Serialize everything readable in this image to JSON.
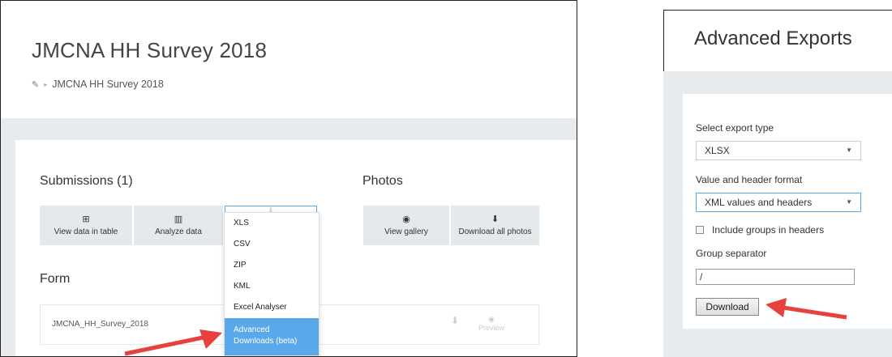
{
  "left": {
    "project_title": "JMCNA HH Survey 2018",
    "breadcrumb": {
      "icon": "link-icon",
      "separator": "▸",
      "item": "JMCNA HH Survey 2018"
    },
    "submissions_title": "Submissions (1)",
    "photos_title": "Photos",
    "form_title": "Form",
    "tiles": {
      "view_table": {
        "icon": "table-icon",
        "glyph": "⊞",
        "label": "View data in table"
      },
      "analyze": {
        "icon": "bar-chart-icon",
        "glyph": "▥",
        "label": "Analyze data"
      },
      "export": {
        "icon": "download-icon",
        "glyph": "⬇"
      },
      "gallery": {
        "icon": "eye-icon",
        "glyph": "◉",
        "label": "View gallery"
      },
      "download_photos": {
        "icon": "download-icon",
        "glyph": "⬇",
        "label": "Download all photos"
      }
    },
    "export_menu": [
      "XLS",
      "CSV",
      "ZIP",
      "KML",
      "Excel Analyser"
    ],
    "export_menu_active": "Advanced Downloads (beta)",
    "form_row": {
      "name": "JMCNA_HH_Survey_2018",
      "download_glyph": "⬇",
      "preview_glyph": "◉",
      "preview_label": "Preview"
    }
  },
  "right": {
    "title": "Advanced Exports",
    "export_type_label": "Select export type",
    "export_type_value": "XLSX",
    "format_label": "Value and header format",
    "format_value": "XML values and headers",
    "caret": "▼",
    "include_groups_label": "Include groups in headers",
    "include_groups_checked": false,
    "group_separator_label": "Group separator",
    "group_separator_value": "/",
    "download_label": "Download"
  },
  "colors": {
    "accent": "#58a8ea",
    "arrow": "#e8413d",
    "band": "#e8ebee"
  }
}
